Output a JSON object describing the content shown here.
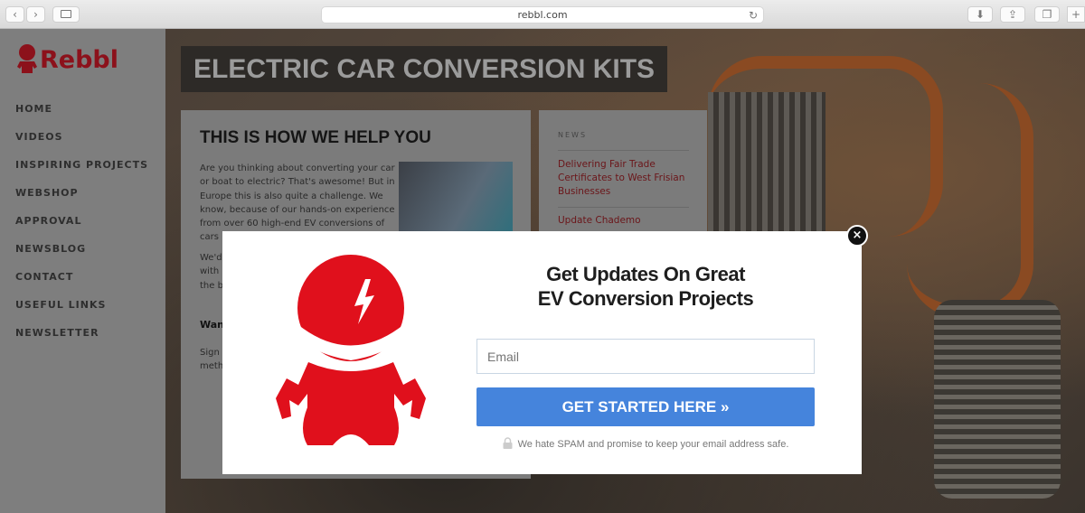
{
  "browser": {
    "url": "rebbl.com",
    "back": "‹",
    "forward": "›"
  },
  "site": {
    "logo_text": "Rebbl",
    "nav": [
      "HOME",
      "VIDEOS",
      "INSPIRING PROJECTS",
      "WEBSHOP",
      "APPROVAL",
      "NEWSBLOG",
      "CONTACT",
      "USEFUL LINKS",
      "NEWSLETTER"
    ],
    "hero_title": "ELECTRIC CAR CONVERSION KITS",
    "help": {
      "title": "THIS IS HOW WE HELP YOU",
      "para1": "Are you thinking about converting your car or boat to electric? That's awesome! But in Europe this is also quite a challenge. We know, because of our hands-on experience from over 60 high-end EV conversions of cars",
      "para2": "We'd with the b",
      "subhead": "Wan",
      "para3": "Sign meth"
    },
    "news": {
      "label": "NEWS",
      "items": [
        "Delivering Fair Trade Certificates to West Frisian Businesses",
        "Update Chademo"
      ]
    }
  },
  "modal": {
    "heading_line1": "Get Updates On Great",
    "heading_line2": "EV Conversion Projects",
    "email_placeholder": "Email",
    "button_label": "GET STARTED HERE  »",
    "privacy_note": "We hate SPAM and promise to keep your email address safe.",
    "close": "×",
    "brand_color": "#e0101c",
    "button_color": "#4584dc"
  }
}
